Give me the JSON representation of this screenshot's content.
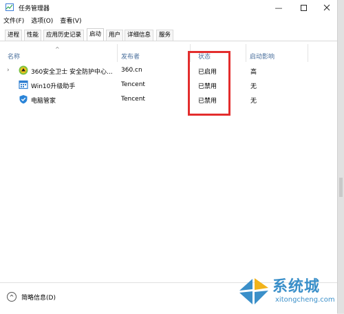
{
  "window": {
    "title": "任务管理器"
  },
  "menu": [
    "文件(F)",
    "选项(O)",
    "查看(V)"
  ],
  "tabs": [
    "进程",
    "性能",
    "应用历史记录",
    "启动",
    "用户",
    "详细信息",
    "服务"
  ],
  "active_tab": "启动",
  "columns": {
    "name": "名称",
    "publisher": "发布者",
    "status": "状态",
    "impact": "启动影响"
  },
  "rows": [
    {
      "name": "360安全卫士 安全防护中心...",
      "publisher": "360.cn",
      "status": "已启用",
      "impact": "高",
      "icon": "360-safe-icon",
      "expandable": true
    },
    {
      "name": "Win10升级助手",
      "publisher": "Tencent",
      "status": "已禁用",
      "impact": "无",
      "icon": "calendar-grid-icon",
      "expandable": false
    },
    {
      "name": "电脑管家",
      "publisher": "Tencent",
      "status": "已禁用",
      "impact": "无",
      "icon": "shield-check-icon",
      "expandable": false
    }
  ],
  "footer": {
    "label": "简略信息(D)"
  },
  "watermark": {
    "brand": "系统城",
    "url": "xitongcheng.com"
  },
  "colors": {
    "highlight": "#e32d2d",
    "header_text": "#4a6f9c",
    "watermark": "#3a8fc9"
  }
}
